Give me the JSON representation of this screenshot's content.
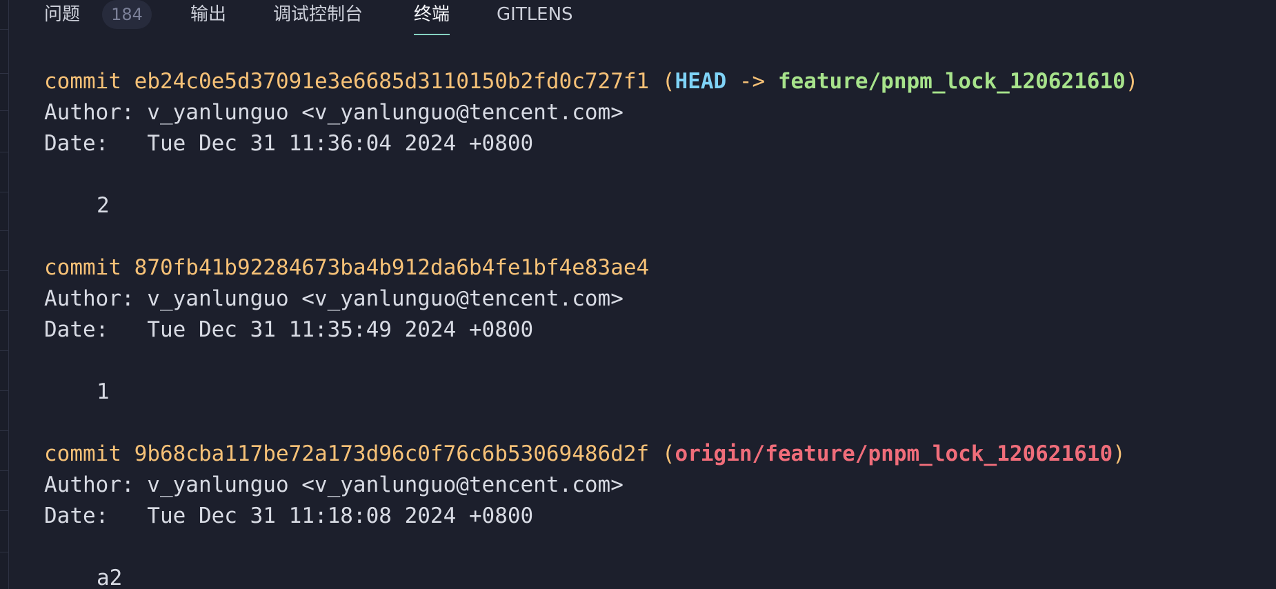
{
  "panel_tabs": [
    {
      "label": "问题",
      "badge": "184",
      "active": false
    },
    {
      "label": "输出",
      "active": false
    },
    {
      "label": "调试控制台",
      "active": false
    },
    {
      "label": "终端",
      "active": true
    },
    {
      "label": "GITLENS",
      "active": false
    }
  ],
  "colors": {
    "background": "#1c1f2c",
    "commit": "#f6c177",
    "head": "#7fd3f7",
    "local_branch": "#a7e38b",
    "remote_branch": "#f06d7a",
    "text": "#d8dbe4",
    "active_tab_underline": "#86d3c2"
  },
  "commits": [
    {
      "keyword": "commit",
      "hash": "eb24c0e5d37091e3e6685d3110150b2fd0c727f1",
      "refs": {
        "head": "HEAD",
        "arrow": "->",
        "branch": "feature/pnpm_lock_120621610"
      },
      "author": "Author: v_yanlunguo <v_yanlunguo@tencent.com>",
      "date": "Date:   Tue Dec 31 11:36:04 2024 +0800",
      "message": "2"
    },
    {
      "keyword": "commit",
      "hash": "870fb41b92284673ba4b912da6b4fe1bf4e83ae4",
      "author": "Author: v_yanlunguo <v_yanlunguo@tencent.com>",
      "date": "Date:   Tue Dec 31 11:35:49 2024 +0800",
      "message": "1"
    },
    {
      "keyword": "commit",
      "hash": "9b68cba117be72a173d96c0f76c6b53069486d2f",
      "refs": {
        "remote_branch": "origin/feature/pnpm_lock_120621610"
      },
      "author": "Author: v_yanlunguo <v_yanlunguo@tencent.com>",
      "date": "Date:   Tue Dec 31 11:18:08 2024 +0800",
      "message": "a2"
    }
  ]
}
